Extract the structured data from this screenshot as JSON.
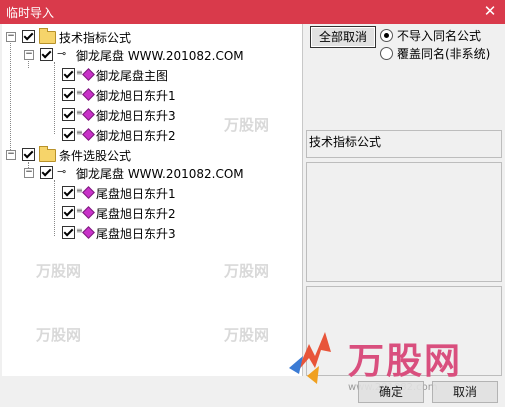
{
  "window": {
    "title": "临时导入",
    "close_glyph": "✕"
  },
  "tree": {
    "groups": [
      {
        "label": "技术指标公式",
        "publisher": "御龙尾盘 WWW.201082.COM",
        "items": [
          "御龙尾盘主图",
          "御龙旭日东升1",
          "御龙旭日东升3",
          "御龙旭日东升2"
        ]
      },
      {
        "label": "条件选股公式",
        "publisher": "御龙尾盘 WWW.201082.COM",
        "items": [
          "尾盘旭日东升1",
          "尾盘旭日东升2",
          "尾盘旭日东升3"
        ]
      }
    ],
    "expander_glyph": "−"
  },
  "right": {
    "cancel_all_button": "全部取消",
    "radio_options": [
      {
        "label": "不导入同名公式",
        "checked": true
      },
      {
        "label": "覆盖同名(非系统)",
        "checked": false
      }
    ],
    "info_label": "技术指标公式"
  },
  "footer": {
    "confirm_button": "确定",
    "cancel_button": "取消"
  },
  "watermark": {
    "logo_text": "万股网",
    "logo_url": "www.201082.com"
  },
  "colors": {
    "titlebar": "#d93a4b",
    "leaf_icon": "#c832c8",
    "folder": "#f6d46a"
  }
}
